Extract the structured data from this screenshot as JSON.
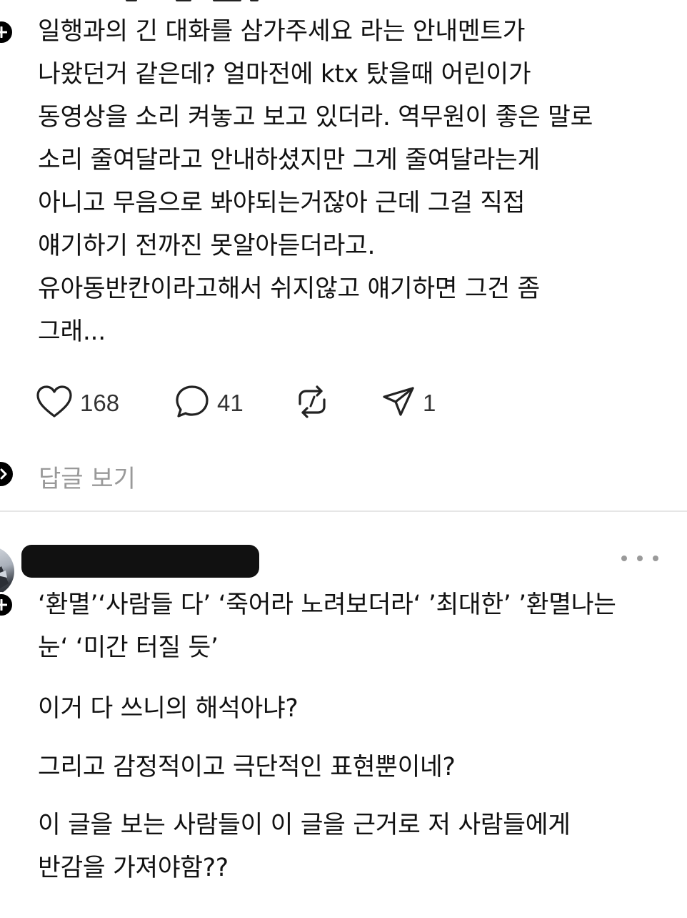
{
  "post1": {
    "text": "일행과의 긴 대화를 삼가주세요 라는 안내멘트가\n나왔던거 같은데? 얼마전에 ktx 탔을때 어린이가\n동영상을 소리 켜놓고 보고 있더라. 역무원이 좋은 말로\n소리 줄여달라고 안내하셨지만 그게 줄여달라는게\n아니고 무음으로 봐야되는거잖아 근데 그걸 직접\n얘기하기 전까진 못알아듣더라고.\n유아동반칸이라고해서 쉬지않고 얘기하면 그건 좀\n그래...",
    "actions": {
      "likes": "168",
      "comments": "41",
      "reposts": "",
      "shares": "1"
    },
    "icons": {
      "like": "heart-icon",
      "comment": "speech-bubble-icon",
      "repost": "repost-arrows-icon",
      "share": "paper-plane-icon"
    },
    "view_replies_label": "답글 보기"
  },
  "post2": {
    "author_redacted": true,
    "paragraphs": [
      "‘환멸’‘사람들 다’ ‘죽어라 노려보더라‘ ’최대한’ ’환멸나는\n눈‘ ‘미간 터질 듯’",
      "이거 다 쓰니의 해석아냐?",
      "그리고 감정적이고 극단적인 표현뿐이네?",
      "이 글을 보는 사람들이 이 글을 근거로 저 사람들에게\n반감을 가져야함??"
    ],
    "more_icon": "more-horizontal-icon"
  },
  "colors": {
    "text": "#111111",
    "muted": "#999999",
    "divider": "#e6e6e6",
    "badge": "#000000"
  }
}
